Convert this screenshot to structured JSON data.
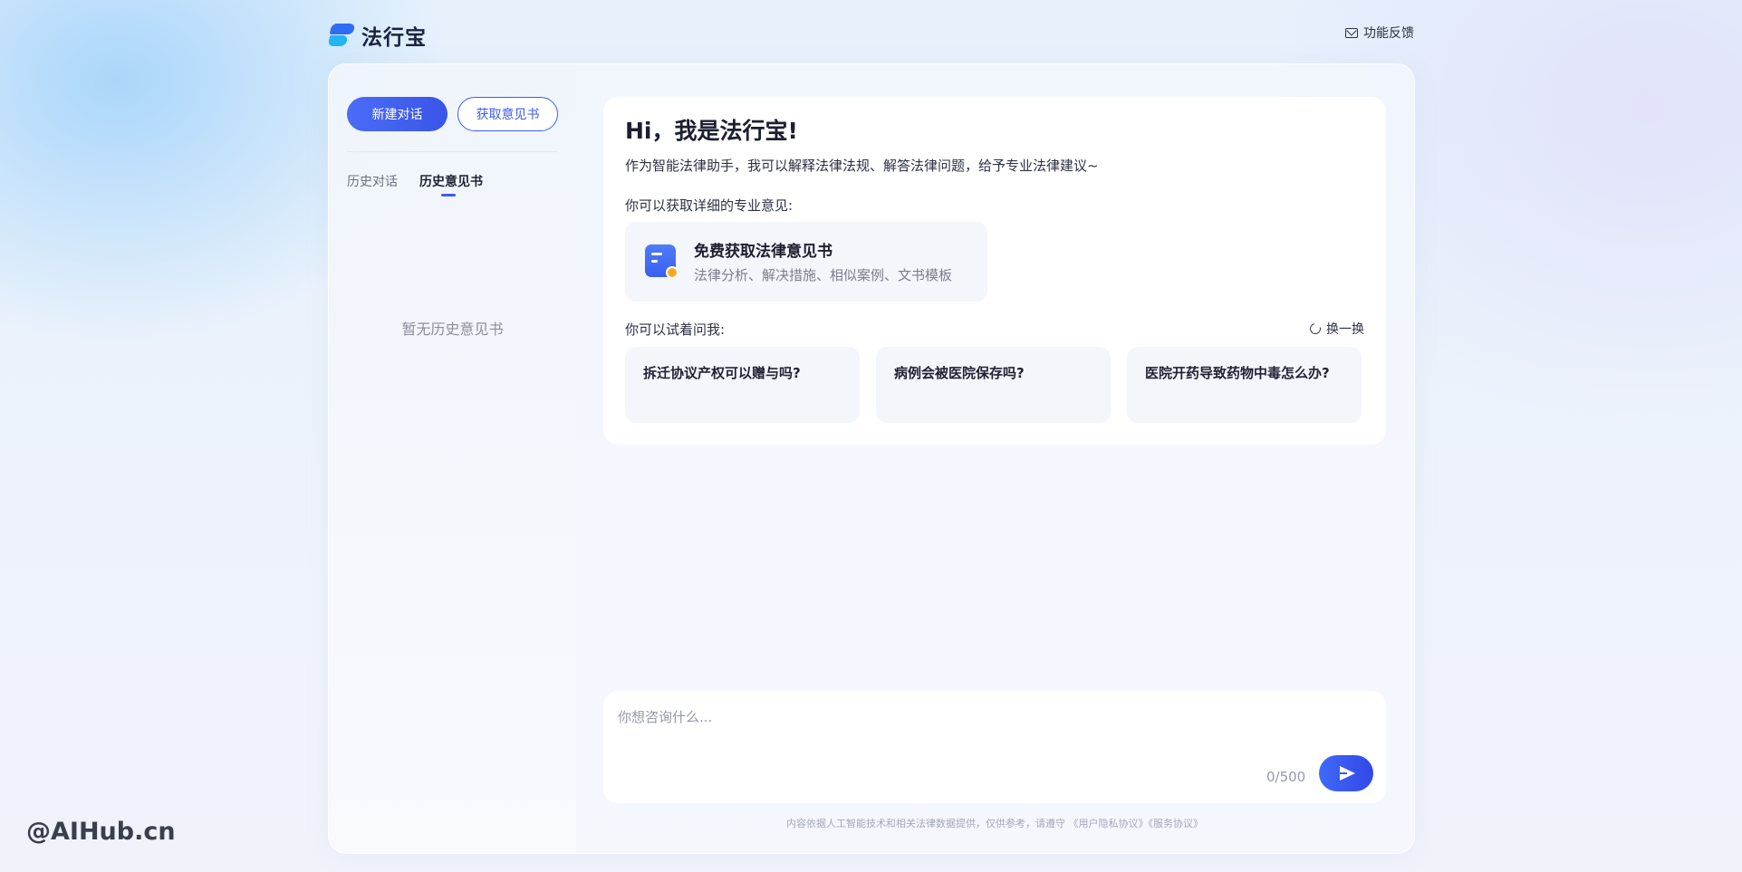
{
  "header": {
    "logo_text": "法行宝",
    "feedback_label": "功能反馈"
  },
  "sidebar": {
    "new_chat_label": "新建对话",
    "get_opinion_label": "获取意见书",
    "tabs": [
      {
        "label": "历史对话",
        "active": false
      },
      {
        "label": "历史意见书",
        "active": true
      }
    ],
    "empty_text": "暂无历史意见书"
  },
  "welcome": {
    "title": "Hi，我是法行宝!",
    "intro": "作为智能法律助手，我可以解释法律法规、解答法律问题，给予专业法律建议~",
    "get_label": "你可以获取详细的专业意见:",
    "opinion_card": {
      "title": "免费获取法律意见书",
      "subtitle": "法律分析、解决措施、相似案例、文书模板"
    },
    "try_label": "你可以试着问我:",
    "refresh_label": "换一换",
    "questions": [
      "拆迁协议产权可以赠与吗?",
      "病例会被医院保存吗?",
      "医院开药导致药物中毒怎么办?"
    ]
  },
  "input": {
    "placeholder": "你想咨询什么...",
    "counter": "0/500"
  },
  "footer_note": "内容依据人工智能技术和相关法律数据提供，仅供参考，请遵守 《用户隐私协议》《服务协议》",
  "watermark": "@AIHub.cn",
  "colors": {
    "accent": "#3d5cf0",
    "logo_blue": "#2f6cf5",
    "logo_cyan": "#24b4f0",
    "badge_orange": "#f7a823"
  }
}
